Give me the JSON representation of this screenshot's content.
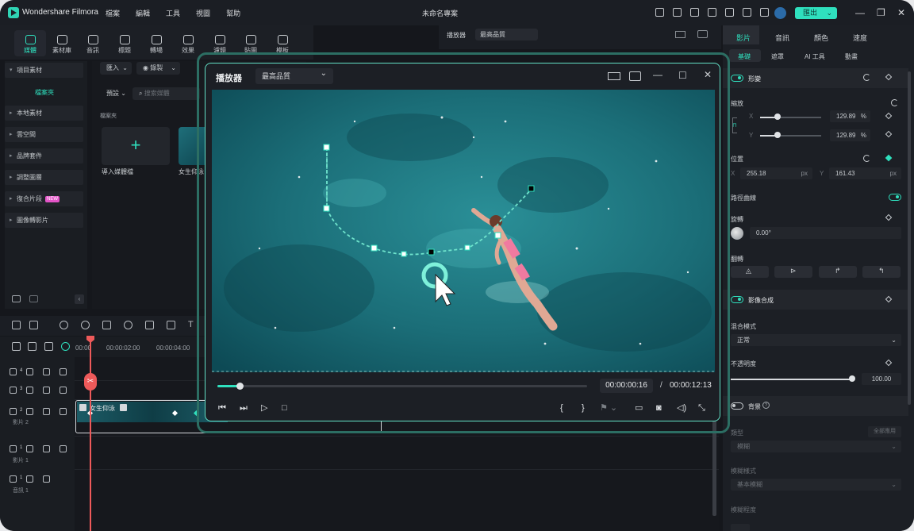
{
  "app": {
    "name": "Wondershare Filmora",
    "menu": [
      "檔案",
      "編輯",
      "工具",
      "視圖",
      "幫助"
    ],
    "doc_title": "未命名專案",
    "export_label": "匯出",
    "accent": "#2fe0be"
  },
  "media_tabs": [
    "媒體",
    "素材庫",
    "音訊",
    "標題",
    "轉場",
    "效果",
    "濾鏡",
    "貼圖",
    "模板"
  ],
  "sidebar": {
    "items": [
      "項目素材",
      "本地素材",
      "雲空間",
      "品牌套件",
      "調整圖層",
      "復合片段",
      "圖像轉影片"
    ],
    "sub_item": "檔案夾",
    "new_badge": "NEW"
  },
  "library": {
    "import_label": "匯入",
    "record_label": "錄製",
    "preset_label": "預設",
    "search_placeholder": "搜索媒體",
    "folder_label": "檔案夾",
    "import_tile_label": "導入媒體檔",
    "clip_label": "女生仰泳"
  },
  "background_player": {
    "title": "播放器",
    "quality": "最高品質"
  },
  "player": {
    "title": "播放器",
    "quality": "最高品質",
    "current_time": "00:00:00:16",
    "separator": "/",
    "total_time": "00:00:12:13",
    "progress": 0.06
  },
  "timeline": {
    "ruler": [
      "00:00",
      "00:00:02:00",
      "00:00:04:00"
    ],
    "tracks": [
      {
        "num": "4",
        "label": ""
      },
      {
        "num": "3",
        "label": ""
      },
      {
        "num": "2",
        "label": "影片 2"
      },
      {
        "num": "1",
        "label": "影片 1"
      },
      {
        "num": "1",
        "label": "音訊 1"
      }
    ],
    "clip_name": "女生仰泳"
  },
  "properties": {
    "tabs": [
      "影片",
      "音訊",
      "顏色",
      "速度"
    ],
    "subtabs": [
      "基礎",
      "遮罩",
      "AI 工具",
      "動畫"
    ],
    "transform_label": "形變",
    "scale_label": "縮放",
    "scale_x_label": "X",
    "scale_x": "129.89",
    "scale_y_label": "Y",
    "scale_y": "129.89",
    "scale_unit": "%",
    "scale_x_level": 0.29,
    "scale_y_level": 0.29,
    "position_label": "位置",
    "pos_x_label": "X",
    "pos_x": "255.18",
    "pos_y_label": "Y",
    "pos_y": "161.43",
    "pos_unit": "px",
    "path_curve_label": "路徑曲線",
    "rotate_label": "旋轉",
    "rotate_value": "0.00°",
    "flip_label": "翻轉",
    "compositing_label": "影像合成",
    "blend_label": "混合模式",
    "blend_value": "正常",
    "opacity_label": "不透明度",
    "opacity_value": "100.00",
    "opacity_level": 1.0,
    "background_label": "背景",
    "type_label": "類型",
    "apply_all_label": "全部應用",
    "type_value": "模糊",
    "blur_style_label": "模糊樣式",
    "blur_style_value": "基本模糊",
    "blur_level_label": "模糊程度"
  }
}
